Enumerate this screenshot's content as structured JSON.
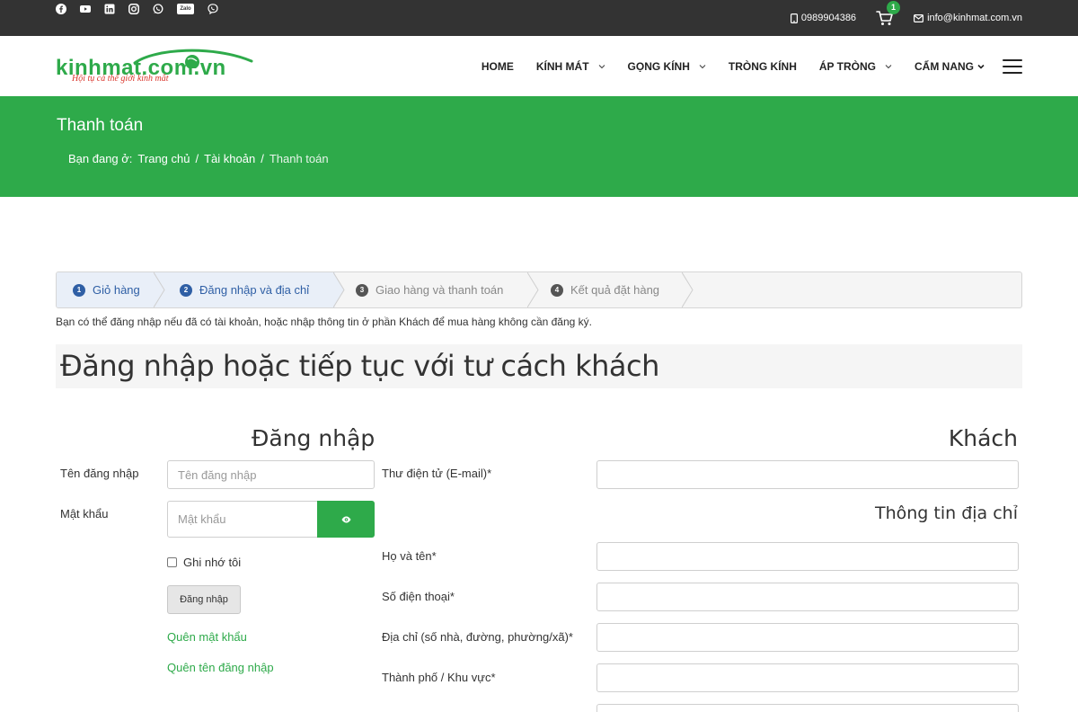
{
  "topbar": {
    "social_icons": [
      "facebook-icon",
      "youtube-icon",
      "linkedin-icon",
      "instagram-icon",
      "whatsapp-icon",
      "zalo-icon",
      "viber-icon"
    ],
    "zalo_label": "Zalo",
    "phone": "0989904386",
    "cart_count": "1",
    "email": "info@kinhmat.com.vn"
  },
  "header": {
    "logo_text": "kinhmat.com.vn",
    "logo_slogan": "Hội tụ cả thế giới kính mắt",
    "nav": [
      {
        "label": "HOME",
        "has_dropdown": false
      },
      {
        "label": "KÍNH MÁT",
        "has_dropdown": true
      },
      {
        "label": "GỌNG KÍNH",
        "has_dropdown": true
      },
      {
        "label": "TRÒNG KÍNH",
        "has_dropdown": false
      },
      {
        "label": "ÁP TRÒNG",
        "has_dropdown": true
      },
      {
        "label": "CẨM NANG",
        "has_dropdown": true
      }
    ]
  },
  "banner": {
    "title": "Thanh toán",
    "breadcrumb_prefix": "Bạn đang ở:",
    "breadcrumb": [
      "Trang chủ",
      "Tài khoản",
      "Thanh toán"
    ],
    "separator": "/"
  },
  "steps": [
    {
      "num": "1",
      "label": "Giỏ hàng",
      "state": "active"
    },
    {
      "num": "2",
      "label": "Đăng nhập và địa chỉ",
      "state": "active"
    },
    {
      "num": "3",
      "label": "Giao hàng và thanh toán",
      "state": "inactive"
    },
    {
      "num": "4",
      "label": "Kết quả đặt hàng",
      "state": "inactive"
    }
  ],
  "info_text": "Bạn có thể đăng nhập nếu đã có tài khoản, hoặc nhập thông tin ở phần Khách để mua hàng không cần đăng ký.",
  "main_heading": "Đăng nhập hoặc tiếp tục với tư cách khách",
  "login": {
    "title": "Đăng nhập",
    "username_label": "Tên đăng nhập",
    "username_placeholder": "Tên đăng nhập",
    "password_label": "Mật khẩu",
    "password_placeholder": "Mật khẩu",
    "remember_label": "Ghi nhớ tôi",
    "submit_label": "Đăng nhập",
    "forgot_password": "Quên mật khẩu",
    "forgot_username": "Quên tên đăng nhập"
  },
  "guest": {
    "title": "Khách",
    "email_label": "Thư điện tử (E-mail)*",
    "address_section_title": "Thông tin địa chỉ",
    "fullname_label": "Họ và tên*",
    "phone_label": "Số điện thoại*",
    "address_label": "Địa chỉ (số nhà, đường, phường/xã)*",
    "city_label": "Thành phố / Khu vực*"
  },
  "colors": {
    "brand_green": "#2eaa4a",
    "topbar_bg": "#333333",
    "step_active": "#2f5fa5",
    "logo_red": "#d9352b"
  }
}
